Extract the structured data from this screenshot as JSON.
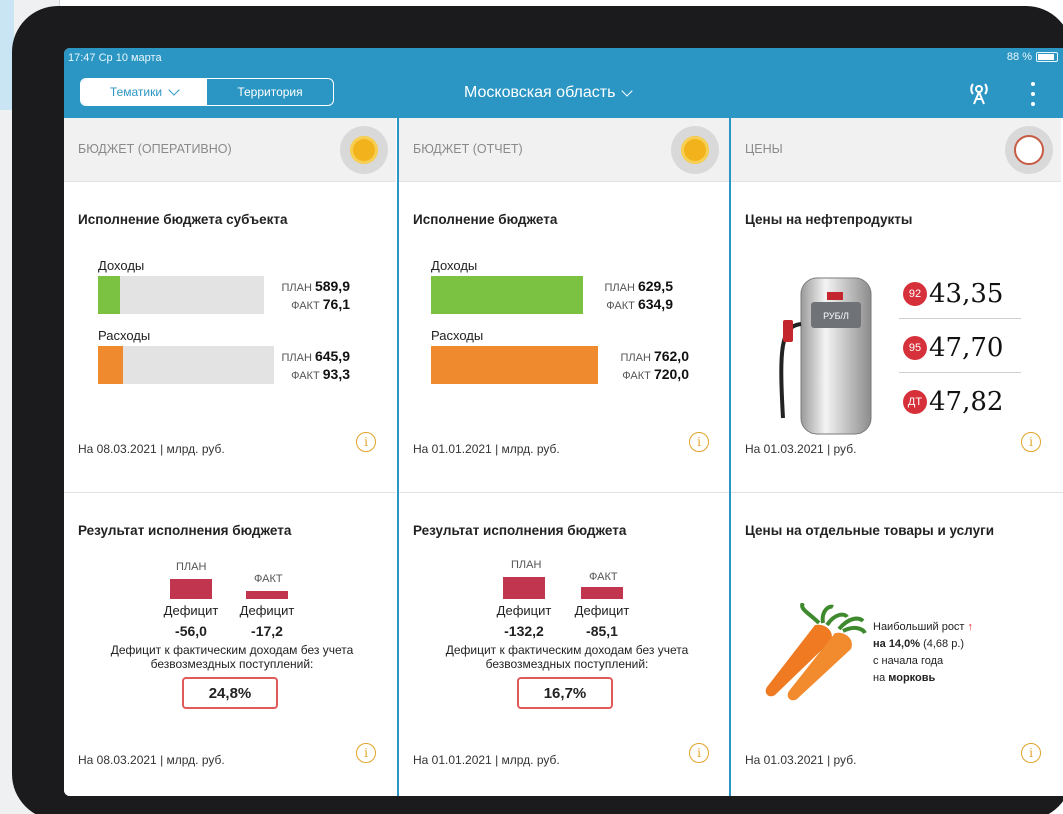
{
  "status_bar": {
    "time": "17:47  Ср 10 марта",
    "battery": "88 %"
  },
  "header": {
    "tabs": [
      {
        "label": "Тематики",
        "active": true
      },
      {
        "label": "Территория",
        "active": false
      }
    ],
    "region": "Московская область"
  },
  "columns": [
    {
      "title": "БЮДЖЕТ (ОПЕРАТИВНО)",
      "top_card": {
        "title": "Исполнение бюджета субъекта",
        "income": {
          "label": "Доходы",
          "plan_label": "ПЛАН",
          "plan": "589,9",
          "fact_label": "ФАКТ",
          "fact": "76,1",
          "fill_fraction": 0.13
        },
        "expense": {
          "label": "Расходы",
          "plan_label": "ПЛАН",
          "plan": "645,9",
          "fact_label": "ФАКТ",
          "fact": "93,3",
          "fill_fraction": 0.14
        },
        "footer": "На 08.03.2021 | млрд. руб."
      },
      "bottom_card": {
        "title": "Результат исполнения бюджета",
        "plan_label": "ПЛАН",
        "fact_label": "ФАКТ",
        "plan_deficit_label": "Дефицит",
        "plan_deficit": "-56,0",
        "fact_deficit_label": "Дефицит",
        "fact_deficit": "-17,2",
        "note": "Дефицит к фактическим доходам без учета безвозмездных поступлений:",
        "percent": "24,8%",
        "footer": "На 08.03.2021 | млрд. руб."
      }
    },
    {
      "title": "БЮДЖЕТ (ОТЧЕТ)",
      "top_card": {
        "title": "Исполнение бюджета",
        "income": {
          "label": "Доходы",
          "plan_label": "ПЛАН",
          "plan": "629,5",
          "fact_label": "ФАКТ",
          "fact": "634,9",
          "fill_fraction": 1.0
        },
        "expense": {
          "label": "Расходы",
          "plan_label": "ПЛАН",
          "plan": "762,0",
          "fact_label": "ФАКТ",
          "fact": "720,0",
          "fill_fraction": 0.95
        },
        "footer": "На 01.01.2021 | млрд. руб."
      },
      "bottom_card": {
        "title": "Результат исполнения бюджета",
        "plan_label": "ПЛАН",
        "fact_label": "ФАКТ",
        "plan_deficit_label": "Дефицит",
        "plan_deficit": "-132,2",
        "fact_deficit_label": "Дефицит",
        "fact_deficit": "-85,1",
        "note": "Дефицит к фактическим доходам без учета безвозмездных поступлений:",
        "percent": "16,7%",
        "footer": "На 01.01.2021 | млрд. руб."
      }
    },
    {
      "title": "ЦЕНЫ",
      "top_card": {
        "title": "Цены на нефтепродукты",
        "pump_label": "РУБ/Л",
        "prices": [
          {
            "tag": "92",
            "value": "43,35"
          },
          {
            "tag": "95",
            "value": "47,70"
          },
          {
            "tag": "ДТ",
            "value": "47,82"
          }
        ],
        "footer": "На 01.03.2021 | руб."
      },
      "bottom_card": {
        "title": "Цены на отдельные товары и услуги",
        "line1": "Наибольший рост",
        "line2_bold": "на 14,0%",
        "line2_rest": " (4,68 р.)",
        "line3": "с начала года",
        "line4_prefix": "на ",
        "line4_bold": "морковь",
        "footer": "На 01.03.2021 | руб."
      }
    }
  ],
  "colors": {
    "accent": "#2b96c3",
    "income_fill": "#7cc242",
    "expense_fill": "#f08a2e",
    "deficit": "#c2354f",
    "tag_red": "#d6313a",
    "info": "#e2a32a"
  },
  "icons": {
    "info": "i"
  }
}
